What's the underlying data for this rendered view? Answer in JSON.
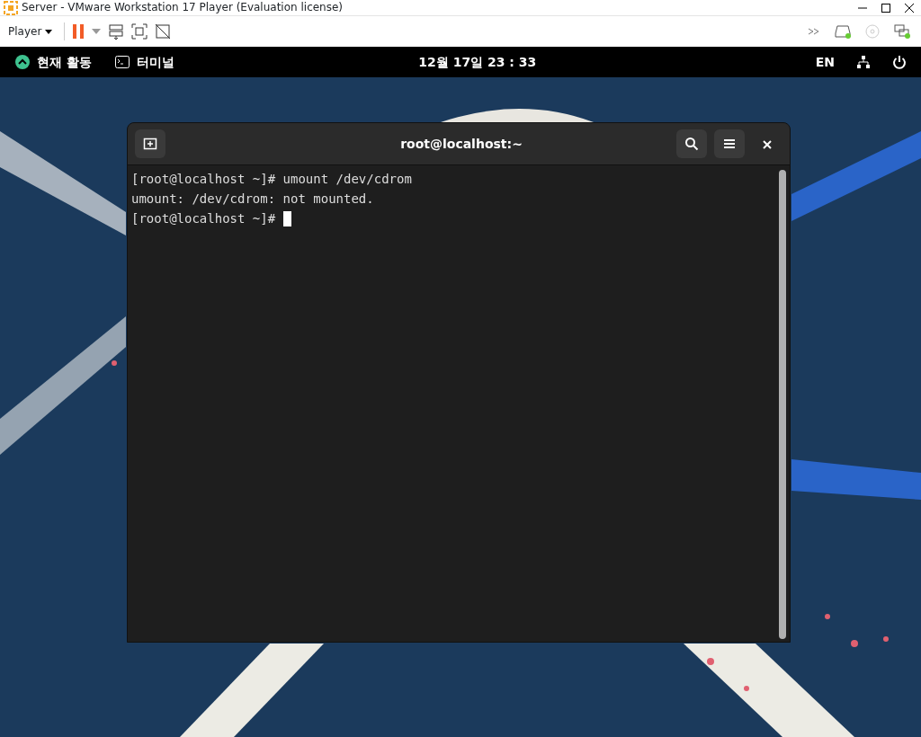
{
  "window": {
    "title": "Server - VMware Workstation 17 Player (Evaluation license)"
  },
  "toolbar": {
    "menu": "Player"
  },
  "top_bar": {
    "activities": "현재 활동",
    "app": "터미널",
    "clock": "12월 17일 23 : 33",
    "input_source": "EN"
  },
  "terminal": {
    "title": "root@localhost:~",
    "lines": [
      {
        "text": "[root@localhost ~]# umount /dev/cdrom",
        "cursor": false
      },
      {
        "text": "umount: /dev/cdrom: not mounted.",
        "cursor": false
      },
      {
        "text": "[root@localhost ~]# ",
        "cursor": true
      }
    ]
  }
}
